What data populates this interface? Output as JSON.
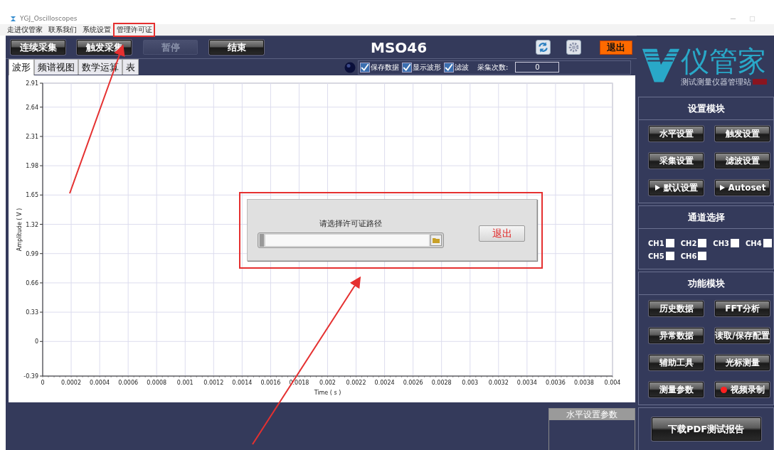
{
  "window": {
    "title": "YGJ_Oscilloscopes"
  },
  "menu": [
    {
      "label": "走进仪管家"
    },
    {
      "label": "联系我们"
    },
    {
      "label": "系统设置"
    },
    {
      "label": "管理许可证"
    }
  ],
  "toolbar": {
    "buttons": [
      {
        "label": "连续采集",
        "disabled": false
      },
      {
        "label": "触发采集",
        "disabled": false
      },
      {
        "label": "暂停",
        "disabled": true
      },
      {
        "label": "结束",
        "disabled": false
      }
    ],
    "title": "MSO46",
    "exit_button": "退出"
  },
  "tabs": [
    {
      "label": "波形",
      "selected": true
    },
    {
      "label": "频谱视图",
      "selected": false
    },
    {
      "label": "数学运算",
      "selected": false
    },
    {
      "label": "表",
      "selected": false
    }
  ],
  "options": [
    {
      "label": "保存数据",
      "checked": true
    },
    {
      "label": "显示波形",
      "checked": true
    },
    {
      "label": "滤波",
      "checked": true
    }
  ],
  "count": {
    "label": "采集次数:",
    "value": "0"
  },
  "chart": {
    "chart_data": {
      "type": "line",
      "grid": true,
      "xlabel": "Time ( s )",
      "ylabel": "Amplitude ( V )",
      "xlim": [
        0,
        0.004
      ],
      "ylim": [
        -0.39,
        2.91
      ],
      "xticks": [
        0,
        0.0002,
        0.0004,
        0.0006,
        0.0008,
        0.001,
        0.0012,
        0.0014,
        0.0016,
        0.0018,
        0.002,
        0.0022,
        0.0024,
        0.0026,
        0.0028,
        0.003,
        0.0032,
        0.0034,
        0.0036,
        0.0038,
        0.004
      ],
      "yticks": [
        2.91,
        2.64,
        2.31,
        1.98,
        1.65,
        1.32,
        0.99,
        0.66,
        0.33,
        0,
        -0.39
      ]
    }
  },
  "dialog": {
    "label": "请选择许可证路径",
    "exit_button": "退出"
  },
  "bottom_panel": {
    "title": "水平设置参数"
  },
  "sidebar": {
    "logo": {
      "name": "仪管家",
      "tagline": "测试测量仪器管理站"
    },
    "sections": [
      {
        "title": "设置模块",
        "kind": "buttons",
        "buttons": [
          {
            "label": "水平设置",
            "kind": "plain"
          },
          {
            "label": "触发设置",
            "kind": "plain"
          },
          {
            "label": "采集设置",
            "kind": "plain"
          },
          {
            "label": "滤波设置",
            "kind": "plain"
          },
          {
            "label": "默认设置",
            "kind": "play"
          },
          {
            "label": "Autoset",
            "kind": "play"
          }
        ]
      },
      {
        "title": "通道选择",
        "kind": "channels",
        "channels": [
          {
            "label": "CH1",
            "checked": false
          },
          {
            "label": "CH2",
            "checked": false
          },
          {
            "label": "CH3",
            "checked": false
          },
          {
            "label": "CH4",
            "checked": false
          },
          {
            "label": "CH5",
            "checked": false
          },
          {
            "label": "CH6",
            "checked": false
          }
        ]
      },
      {
        "title": "功能模块",
        "kind": "buttons",
        "buttons": [
          {
            "label": "历史数据",
            "kind": "plain"
          },
          {
            "label": "FFT分析",
            "kind": "plain"
          },
          {
            "label": "异常数据",
            "kind": "plain"
          },
          {
            "label": "读取/保存配置",
            "kind": "plain"
          },
          {
            "label": "辅助工具",
            "kind": "plain"
          },
          {
            "label": "光标测量",
            "kind": "plain"
          },
          {
            "label": "测量参数",
            "kind": "plain"
          },
          {
            "label": "视频录制",
            "kind": "record"
          }
        ]
      }
    ],
    "report_button": "下载PDF测试报告"
  }
}
